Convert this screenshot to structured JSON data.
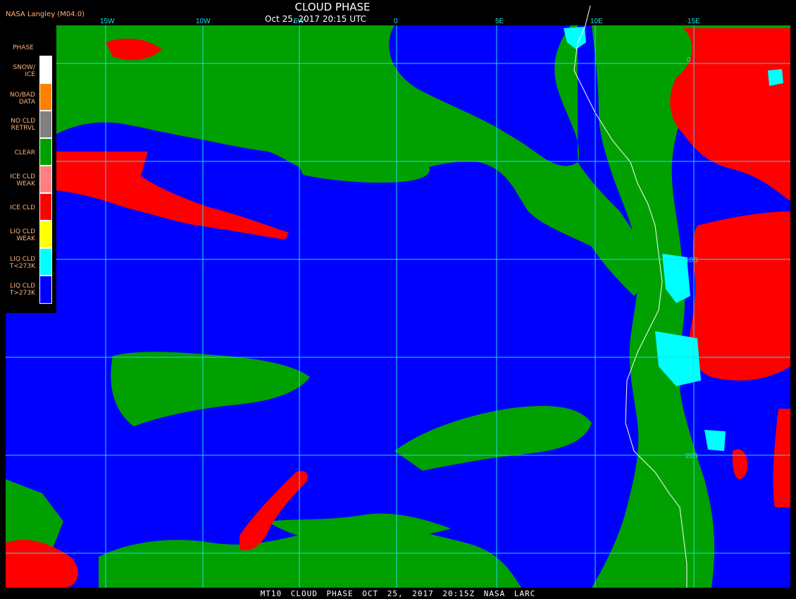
{
  "header": {
    "product": "NASA Langley (M04.0)",
    "title": "CLOUD PHASE",
    "timestamp": "Oct 25, 2017 20:15 UTC"
  },
  "footer": {
    "text": "MT10  CLOUD PHASE  OCT 25, 2017 20:15Z  NASA LARC"
  },
  "legend": {
    "heading": "PHASE",
    "items": [
      {
        "label": "SNOW/ ICE",
        "color": "#ffffff"
      },
      {
        "label": "NO/BAD DATA",
        "color": "#ff8000"
      },
      {
        "label": "NO CLD RETRVL",
        "color": "#808080"
      },
      {
        "label": "CLEAR",
        "color": "#00a000"
      },
      {
        "label": "ICE CLD WEAK",
        "color": "#ff8080"
      },
      {
        "label": "ICE CLD",
        "color": "#ff0000"
      },
      {
        "label": "LIQ CLD WEAK",
        "color": "#ffff00"
      },
      {
        "label": "LIQ CLD T<273K",
        "color": "#00ffff"
      },
      {
        "label": "LIQ CLD T>273K",
        "color": "#0000ff"
      }
    ]
  },
  "grid": {
    "lon_labels": [
      "15W",
      "10W",
      "5W",
      "0",
      "5E",
      "10E",
      "15E"
    ],
    "lat_labels": [
      "0",
      "10S",
      "20S"
    ],
    "color": "#19e0e6"
  }
}
